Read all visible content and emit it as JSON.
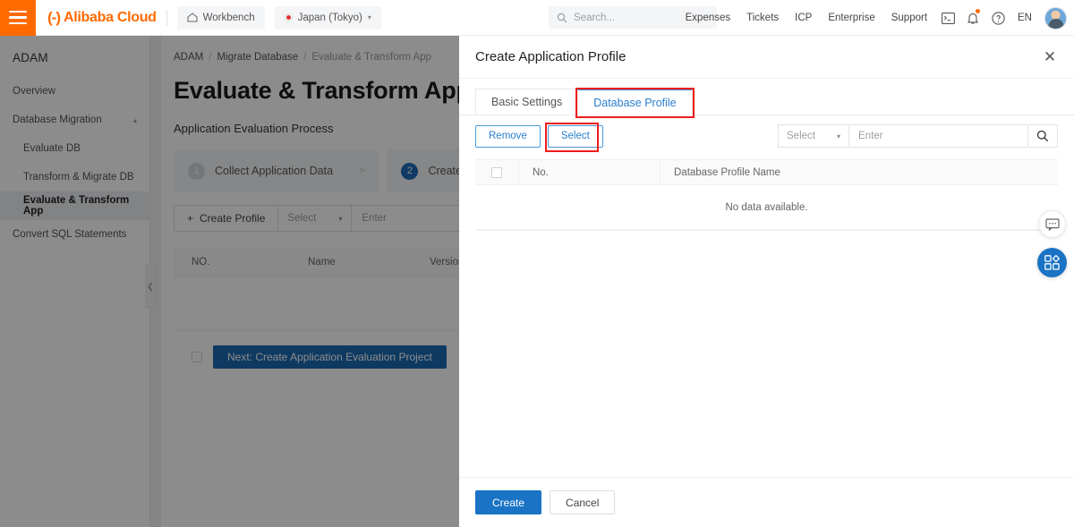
{
  "header": {
    "menu_icon": "hamburger-icon",
    "logo_mark": "(-)",
    "logo_text": "Alibaba Cloud",
    "workbench_label": "Workbench",
    "workbench_icon": "home-icon",
    "region_label": "Japan (Tokyo)",
    "search_placeholder": "Search...",
    "search_icon": "search-icon",
    "nav_links": [
      "Expenses",
      "Tickets",
      "ICP",
      "Enterprise",
      "Support"
    ],
    "icons": [
      "terminal-icon",
      "bell-icon",
      "help-circle-icon"
    ],
    "language": "EN",
    "avatar": "user-avatar",
    "notification_badge": true
  },
  "sidebar": {
    "title": "ADAM",
    "items": [
      {
        "label": "Overview",
        "level": 0,
        "active": false,
        "expandable": false
      },
      {
        "label": "Database Migration",
        "level": 0,
        "active": false,
        "expandable": true,
        "chevron": "chevron-up-icon"
      },
      {
        "label": "Evaluate DB",
        "level": 1,
        "active": false,
        "expandable": false
      },
      {
        "label": "Transform & Migrate DB",
        "level": 1,
        "active": false,
        "expandable": false
      },
      {
        "label": "Evaluate & Transform App",
        "level": 1,
        "active": true,
        "expandable": false
      },
      {
        "label": "Convert SQL Statements",
        "level": 0,
        "active": false,
        "expandable": false
      }
    ],
    "collapse_icon": "chevron-left-icon"
  },
  "main": {
    "breadcrumb": [
      "ADAM",
      "Migrate Database",
      "Evaluate & Transform App"
    ],
    "page_title": "Evaluate & Transform App",
    "section_heading": "Application Evaluation Process",
    "steps": [
      {
        "num": "1",
        "label": "Collect Application Data",
        "active": false,
        "arrow": ">"
      },
      {
        "num": "2",
        "label": "Create Applicat",
        "active": true,
        "arrow": ""
      }
    ],
    "toolbar": {
      "create_profile_label": "Create Profile",
      "plus_icon": "plus-icon",
      "select_placeholder": "Select",
      "enter_placeholder": "Enter",
      "chevron_icon": "chevron-down-icon"
    },
    "table_columns": [
      "NO.",
      "Name",
      "Version"
    ],
    "next_button_label": "Next: Create Application Evaluation Project"
  },
  "drawer": {
    "title": "Create Application Profile",
    "close_icon": "close-icon",
    "tabs": [
      {
        "label": "Basic Settings",
        "active": false,
        "annotated": false
      },
      {
        "label": "Database Profile",
        "active": true,
        "annotated": true
      }
    ],
    "toolbar": {
      "remove_label": "Remove",
      "select_label": "Select",
      "select_annotated": true,
      "filter_select_placeholder": "Select",
      "filter_input_placeholder": "Enter",
      "search_icon": "search-icon",
      "chevron_icon": "chevron-down-icon"
    },
    "table": {
      "columns": [
        "No.",
        "Database Profile Name"
      ],
      "select_all_checkbox": false,
      "rows": [],
      "empty_message": "No data available."
    },
    "footer": {
      "create_label": "Create",
      "cancel_label": "Cancel"
    }
  },
  "floating_buttons": [
    {
      "icon": "chat-bubble-icon",
      "style": "white"
    },
    {
      "icon": "apps-grid-icon",
      "style": "blue"
    }
  ],
  "colors": {
    "brand_orange": "#FF6A00",
    "accent_blue": "#1a73c4",
    "tab_active_blue": "#2a7fce",
    "annotation_red": "#f01c1c",
    "overlay": "rgba(0,0,0,0.45)"
  }
}
